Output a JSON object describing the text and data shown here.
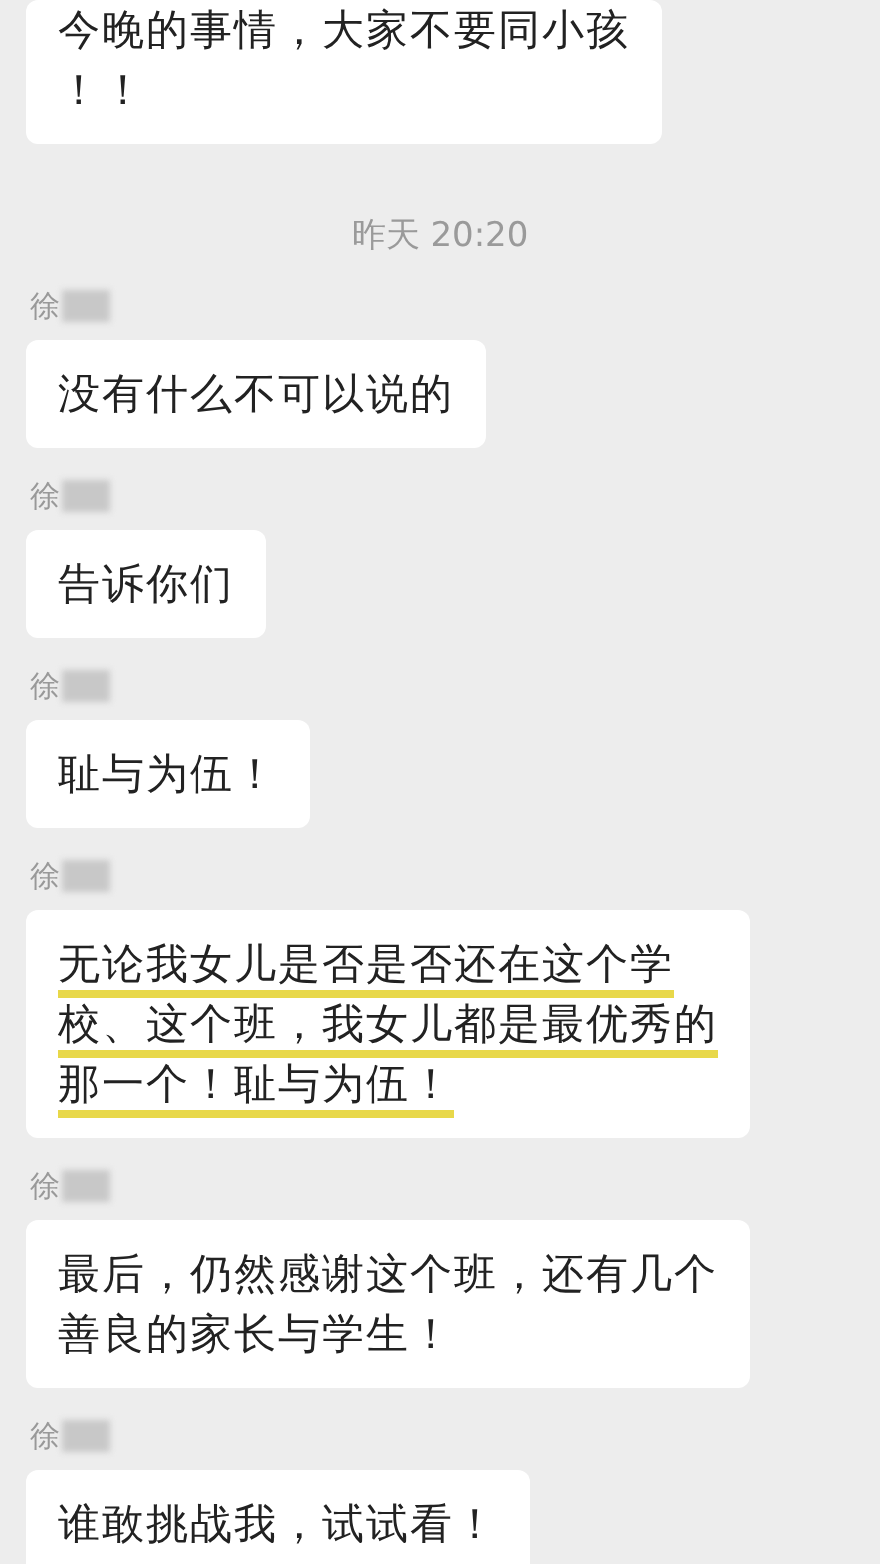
{
  "messages": [
    {
      "kind": "message",
      "lines": [
        "今晚的事情，大家不要同小孩",
        "！！"
      ],
      "highlighted": false
    },
    {
      "kind": "time",
      "text": "昨天 20:20"
    },
    {
      "kind": "message",
      "sender": "徐",
      "lines": [
        "没有什么不可以说的"
      ],
      "highlighted": false
    },
    {
      "kind": "message",
      "sender": "徐",
      "lines": [
        "告诉你们"
      ],
      "highlighted": false
    },
    {
      "kind": "message",
      "sender": "徐",
      "lines": [
        "耻与为伍！"
      ],
      "highlighted": false
    },
    {
      "kind": "message",
      "sender": "徐",
      "lines": [
        "无论我女儿是否是否还在这个学",
        "校、这个班，我女儿都是最优秀的",
        "那一个！耻与为伍！"
      ],
      "highlighted": true
    },
    {
      "kind": "message",
      "sender": "徐",
      "lines": [
        "最后，仍然感谢这个班，还有几个",
        "善良的家长与学生！"
      ],
      "highlighted": false
    },
    {
      "kind": "message",
      "sender": "徐",
      "lines": [
        "谁敢挑战我，试试看！"
      ],
      "highlighted": false
    }
  ]
}
